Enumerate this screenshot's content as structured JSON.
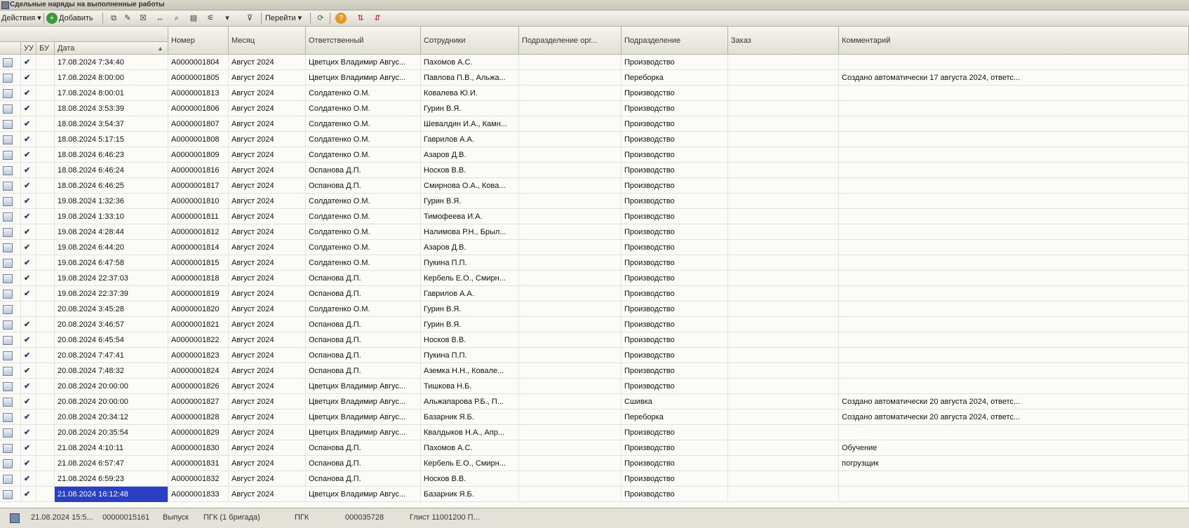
{
  "window": {
    "title": "Сдельные наряды на выполненные работы"
  },
  "toolbar": {
    "actions_label": "Действия",
    "add_label": "Добавить",
    "goto_label": "Перейти"
  },
  "columns": {
    "uu": "УУ",
    "bu": "БУ",
    "date": "Дата",
    "number": "Номер",
    "month": "Месяц",
    "responsible": "Ответственный",
    "employees": "Сотрудники",
    "org_division": "Подразделение орг...",
    "division": "Подразделение",
    "order": "Заказ",
    "comment": "Комментарий"
  },
  "rows": [
    {
      "date": "17.08.2024 7:34:40",
      "number": "А0000001804",
      "month": "Август 2024",
      "responsible": "Цветцих Владимир Авгус...",
      "employees": "Пахомов А.С.",
      "division": "Производство",
      "comment": "",
      "uu": true
    },
    {
      "date": "17.08.2024 8:00:00",
      "number": "А0000001805",
      "month": "Август 2024",
      "responsible": "Цветцих Владимир Авгус...",
      "employees": "Павлова П.В., Альжа...",
      "division": "Переборка",
      "comment": "Создано автоматически 17 августа 2024, ответс...",
      "uu": true
    },
    {
      "date": "17.08.2024 8:00:01",
      "number": "А0000001813",
      "month": "Август 2024",
      "responsible": "Солдатенко О.М.",
      "employees": "Ковалева Ю.И.",
      "division": "Производство",
      "comment": "",
      "uu": true
    },
    {
      "date": "18.08.2024 3:53:39",
      "number": "А0000001806",
      "month": "Август 2024",
      "responsible": "Солдатенко О.М.",
      "employees": "Гурин В.Я.",
      "division": "Производство",
      "comment": "",
      "uu": true
    },
    {
      "date": "18.08.2024 3:54:37",
      "number": "А0000001807",
      "month": "Август 2024",
      "responsible": "Солдатенко О.М.",
      "employees": "Шевалдин И.А., Камн...",
      "division": "Производство",
      "comment": "",
      "uu": true
    },
    {
      "date": "18.08.2024 5:17:15",
      "number": "А0000001808",
      "month": "Август 2024",
      "responsible": "Солдатенко О.М.",
      "employees": "Гаврилов А.А.",
      "division": "Производство",
      "comment": "",
      "uu": true
    },
    {
      "date": "18.08.2024 6:46:23",
      "number": "А0000001809",
      "month": "Август 2024",
      "responsible": "Солдатенко О.М.",
      "employees": "Азаров Д.В.",
      "division": "Производство",
      "comment": "",
      "uu": true
    },
    {
      "date": "18.08.2024 6:46:24",
      "number": "А0000001816",
      "month": "Август 2024",
      "responsible": "Оспанова Д.П.",
      "employees": "Носков В.В.",
      "division": "Производство",
      "comment": "",
      "uu": true
    },
    {
      "date": "18.08.2024 6:46:25",
      "number": "А0000001817",
      "month": "Август 2024",
      "responsible": "Оспанова Д.П.",
      "employees": "Смирнова О.А., Кова...",
      "division": "Производство",
      "comment": "",
      "uu": true
    },
    {
      "date": "19.08.2024 1:32:36",
      "number": "А0000001810",
      "month": "Август 2024",
      "responsible": "Солдатенко О.М.",
      "employees": "Гурин В.Я.",
      "division": "Производство",
      "comment": "",
      "uu": true
    },
    {
      "date": "19.08.2024 1:33:10",
      "number": "А0000001811",
      "month": "Август 2024",
      "responsible": "Солдатенко О.М.",
      "employees": "Тимофеева И.А.",
      "division": "Производство",
      "comment": "",
      "uu": true
    },
    {
      "date": "19.08.2024 4:28:44",
      "number": "А0000001812",
      "month": "Август 2024",
      "responsible": "Солдатенко О.М.",
      "employees": "Налимова Р.Н., Брыл...",
      "division": "Производство",
      "comment": "",
      "uu": true
    },
    {
      "date": "19.08.2024 6:44:20",
      "number": "А0000001814",
      "month": "Август 2024",
      "responsible": "Солдатенко О.М.",
      "employees": "Азаров Д.В.",
      "division": "Производство",
      "comment": "",
      "uu": true
    },
    {
      "date": "19.08.2024 6:47:58",
      "number": "А0000001815",
      "month": "Август 2024",
      "responsible": "Солдатенко О.М.",
      "employees": "Пукина П.П.",
      "division": "Производство",
      "comment": "",
      "uu": true
    },
    {
      "date": "19.08.2024 22:37:03",
      "number": "А0000001818",
      "month": "Август 2024",
      "responsible": "Оспанова Д.П.",
      "employees": "Кербель Е.О., Смирн...",
      "division": "Производство",
      "comment": "",
      "uu": true
    },
    {
      "date": "19.08.2024 22:37:39",
      "number": "А0000001819",
      "month": "Август 2024",
      "responsible": "Оспанова Д.П.",
      "employees": "Гаврилов А.А.",
      "division": "Производство",
      "comment": "",
      "uu": true
    },
    {
      "date": "20.08.2024 3:45:28",
      "number": "А0000001820",
      "month": "Август 2024",
      "responsible": "Солдатенко О.М.",
      "employees": "Гурин В.Я.",
      "division": "Производство",
      "comment": "",
      "uu": false
    },
    {
      "date": "20.08.2024 3:46:57",
      "number": "А0000001821",
      "month": "Август 2024",
      "responsible": "Оспанова Д.П.",
      "employees": "Гурин В.Я.",
      "division": "Производство",
      "comment": "",
      "uu": true
    },
    {
      "date": "20.08.2024 6:45:54",
      "number": "А0000001822",
      "month": "Август 2024",
      "responsible": "Оспанова Д.П.",
      "employees": "Носков В.В.",
      "division": "Производство",
      "comment": "",
      "uu": true
    },
    {
      "date": "20.08.2024 7:47:41",
      "number": "А0000001823",
      "month": "Август 2024",
      "responsible": "Оспанова Д.П.",
      "employees": "Пукина П.П.",
      "division": "Производство",
      "comment": "",
      "uu": true
    },
    {
      "date": "20.08.2024 7:48:32",
      "number": "А0000001824",
      "month": "Август 2024",
      "responsible": "Оспанова Д.П.",
      "employees": "Аземка Н.Н., Ковале...",
      "division": "Производство",
      "comment": "",
      "uu": true
    },
    {
      "date": "20.08.2024 20:00:00",
      "number": "А0000001826",
      "month": "Август 2024",
      "responsible": "Цветцих Владимир Авгус...",
      "employees": "Тишкова Н.Б.",
      "division": "Производство",
      "comment": "",
      "uu": true
    },
    {
      "date": "20.08.2024 20:00:00",
      "number": "А0000001827",
      "month": "Август 2024",
      "responsible": "Цветцих Владимир Авгус...",
      "employees": "Альжапарова Р.Б., П...",
      "division": "Сшивка",
      "comment": "Создано автоматически 20 августа 2024, ответс...",
      "uu": true
    },
    {
      "date": "20.08.2024 20:34:12",
      "number": "А0000001828",
      "month": "Август 2024",
      "responsible": "Цветцих Владимир Авгус...",
      "employees": "Базарник Я.Б.",
      "division": "Переборка",
      "comment": "Создано автоматически 20 августа 2024, ответс...",
      "uu": true
    },
    {
      "date": "20.08.2024 20:35:54",
      "number": "А0000001829",
      "month": "Август 2024",
      "responsible": "Цветцих Владимир Авгус...",
      "employees": "Квалдыков Н.А., Апр...",
      "division": "Производство",
      "comment": "",
      "uu": true
    },
    {
      "date": "21.08.2024 4:10:11",
      "number": "А0000001830",
      "month": "Август 2024",
      "responsible": "Оспанова Д.П.",
      "employees": "Пахомов А.С.",
      "division": "Производство",
      "comment": "Обучение",
      "uu": true
    },
    {
      "date": "21.08.2024 6:57:47",
      "number": "А0000001831",
      "month": "Август 2024",
      "responsible": "Оспанова Д.П.",
      "employees": "Кербель Е.О., Смирн...",
      "division": "Производство",
      "comment": "погрузщик",
      "uu": true
    },
    {
      "date": "21.08.2024 6:59:23",
      "number": "А0000001832",
      "month": "Август 2024",
      "responsible": "Оспанова Д.П.",
      "employees": "Носков В.В.",
      "division": "Производство",
      "comment": "",
      "uu": true
    },
    {
      "date": "21.08.2024 16:12:48",
      "number": "А0000001833",
      "month": "Август 2024",
      "responsible": "Цветцих Владимир Авгус...",
      "employees": "Базарник Я.Б.",
      "division": "Производство",
      "comment": "",
      "uu": true,
      "selected": true
    }
  ],
  "status_bar": {
    "date": "21.08.2024 15:5...",
    "number": "00000015161",
    "release": "Выпуск",
    "brigade": "ПГК (1 бригада)",
    "org": "ПГК",
    "code": "000035728",
    "extra": "Глист 11001200 П..."
  },
  "colors": {
    "selected": "#2b3fc4",
    "check": "#1d3a7a"
  }
}
